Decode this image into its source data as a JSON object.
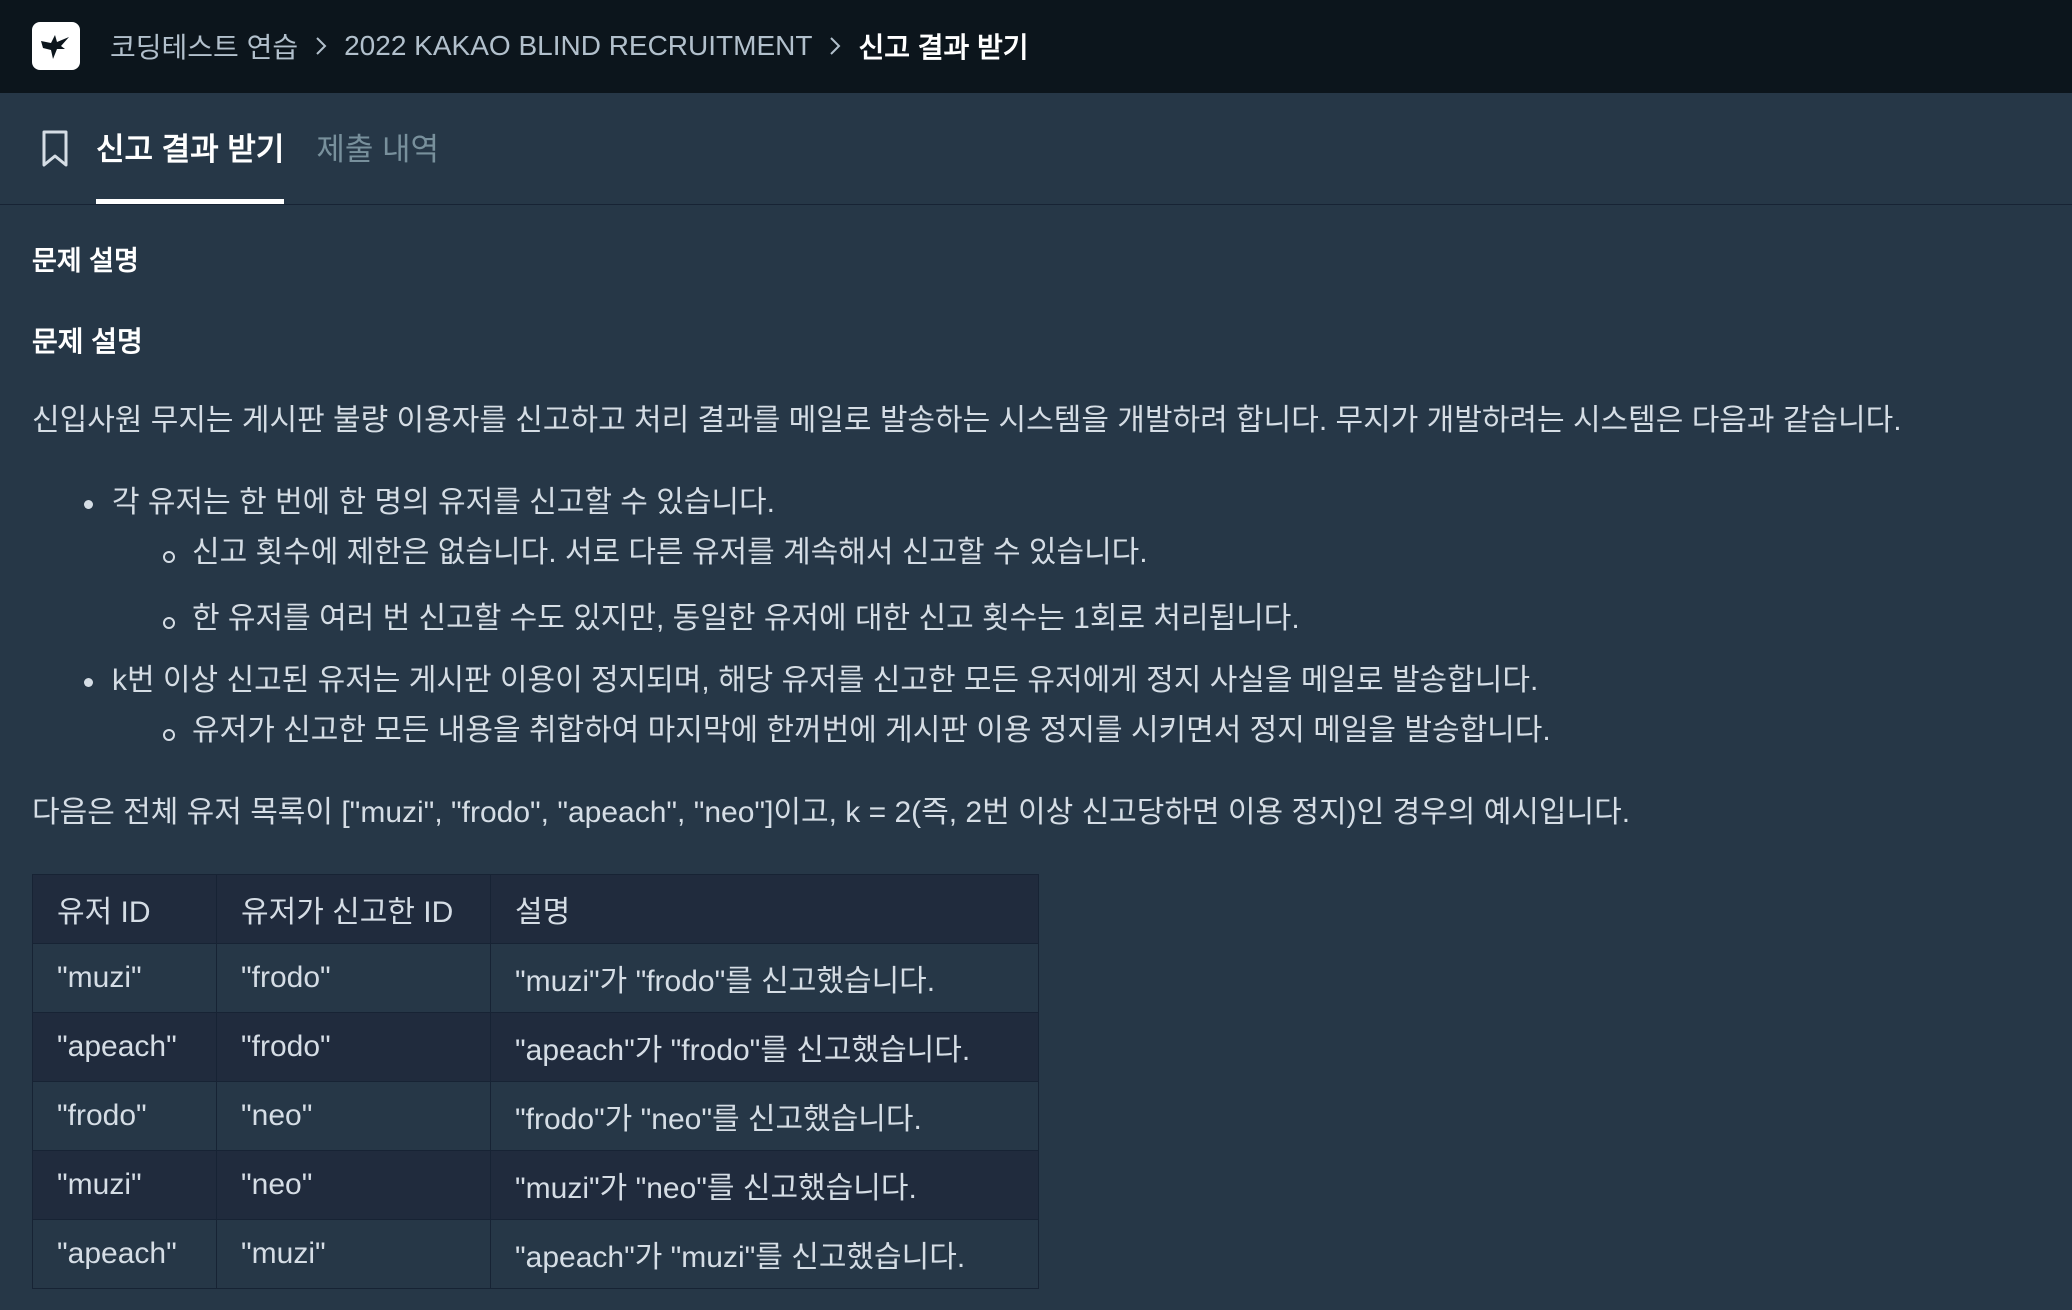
{
  "breadcrumb": {
    "items": [
      "코딩테스트 연습",
      "2022 KAKAO BLIND RECRUITMENT",
      "신고 결과 받기"
    ]
  },
  "tabs": [
    {
      "label": "신고 결과 받기",
      "active": true
    },
    {
      "label": "제출 내역",
      "active": false
    }
  ],
  "content": {
    "section_title": "문제 설명",
    "sub_title": "문제 설명",
    "intro": "신입사원 무지는 게시판 불량 이용자를 신고하고 처리 결과를 메일로 발송하는 시스템을 개발하려 합니다. 무지가 개발하려는 시스템은 다음과 같습니다.",
    "bullets": [
      {
        "text": "각 유저는 한 번에 한 명의 유저를 신고할 수 있습니다.",
        "sub": [
          "신고 횟수에 제한은 없습니다. 서로 다른 유저를 계속해서 신고할 수 있습니다.",
          "한 유저를 여러 번 신고할 수도 있지만, 동일한 유저에 대한 신고 횟수는 1회로 처리됩니다."
        ]
      },
      {
        "text": "k번 이상 신고된 유저는 게시판 이용이 정지되며, 해당 유저를 신고한 모든 유저에게 정지 사실을 메일로 발송합니다.",
        "sub": [
          "유저가 신고한 모든 내용을 취합하여 마지막에 한꺼번에 게시판 이용 정지를 시키면서 정지 메일을 발송합니다."
        ]
      }
    ],
    "example_intro": "다음은 전체 유저 목록이 [\"muzi\", \"frodo\", \"apeach\", \"neo\"]이고, k = 2(즉, 2번 이상 신고당하면 이용 정지)인 경우의 예시입니다.",
    "table": {
      "headers": [
        "유저 ID",
        "유저가 신고한 ID",
        "설명"
      ],
      "rows": [
        [
          "\"muzi\"",
          "\"frodo\"",
          "\"muzi\"가 \"frodo\"를 신고했습니다."
        ],
        [
          "\"apeach\"",
          "\"frodo\"",
          "\"apeach\"가 \"frodo\"를 신고했습니다."
        ],
        [
          "\"frodo\"",
          "\"neo\"",
          "\"frodo\"가 \"neo\"를 신고했습니다."
        ],
        [
          "\"muzi\"",
          "\"neo\"",
          "\"muzi\"가 \"neo\"를 신고했습니다."
        ],
        [
          "\"apeach\"",
          "\"muzi\"",
          "\"apeach\"가 \"muzi\"를 신고했습니다."
        ]
      ]
    }
  },
  "colors": {
    "topbar_bg": "#0c151c",
    "page_bg": "#263747",
    "table_bg": "#202b3d",
    "text": "#d5dde5",
    "muted": "#78909c"
  }
}
